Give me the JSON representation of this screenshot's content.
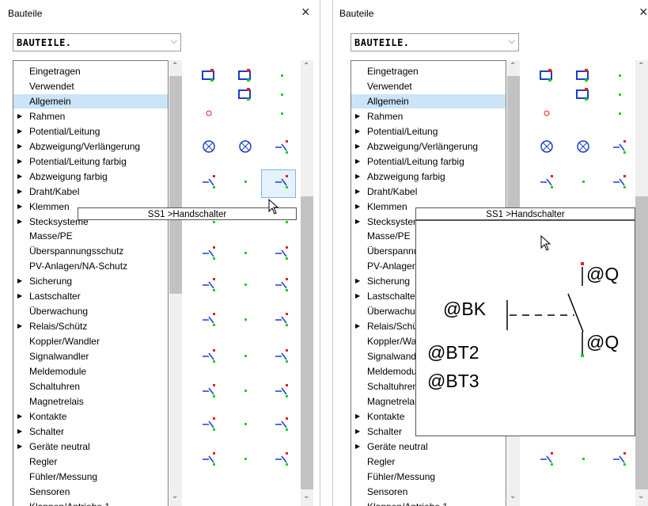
{
  "panels": [
    {
      "title": "Bauteile",
      "close": "×",
      "combo_value": "BAUTEILE.",
      "combo_arrow": "⌵"
    },
    {
      "title": "Bauteile",
      "close": "×",
      "combo_value": "BAUTEILE.",
      "combo_arrow": "⌵"
    }
  ],
  "list_items": [
    {
      "label": "Eingetragen",
      "expandable": false
    },
    {
      "label": "Verwendet",
      "expandable": false
    },
    {
      "label": "Allgemein",
      "expandable": false,
      "selected": true
    },
    {
      "label": "Rahmen",
      "expandable": true
    },
    {
      "label": "Potential/Leitung",
      "expandable": true
    },
    {
      "label": "Abzweigung/Verlängerung",
      "expandable": true
    },
    {
      "label": "Potential/Leitung  farbig",
      "expandable": true
    },
    {
      "label": "Abzweigung       farbig",
      "expandable": true
    },
    {
      "label": "Draht/Kabel",
      "expandable": true
    },
    {
      "label": "Klemmen",
      "expandable": true
    },
    {
      "label": "Stecksysteme",
      "expandable": true
    },
    {
      "label": "Masse/PE",
      "expandable": false
    },
    {
      "label": "Überspannungsschutz",
      "expandable": false
    },
    {
      "label": "PV-Anlagen/NA-Schutz",
      "expandable": false
    },
    {
      "label": "Sicherung",
      "expandable": true
    },
    {
      "label": "Lastschalter",
      "expandable": true
    },
    {
      "label": "Überwachung",
      "expandable": false
    },
    {
      "label": "Relais/Schütz",
      "expandable": true
    },
    {
      "label": "Koppler/Wandler",
      "expandable": false
    },
    {
      "label": "Signalwandler",
      "expandable": false
    },
    {
      "label": "Meldemodule",
      "expandable": false
    },
    {
      "label": "Schaltuhren",
      "expandable": false
    },
    {
      "label": "Magnetrelais",
      "expandable": false
    },
    {
      "label": "Kontakte",
      "expandable": true
    },
    {
      "label": "Schalter",
      "expandable": true
    },
    {
      "label": "Geräte neutral",
      "expandable": true
    },
    {
      "label": "Regler",
      "expandable": false
    },
    {
      "label": "Fühler/Messung",
      "expandable": false
    },
    {
      "label": "Sensoren",
      "expandable": false
    },
    {
      "label": "Klappen/Antriebe 1",
      "expandable": false
    }
  ],
  "tooltip": "SS1 >Handschalter",
  "preview": {
    "q1": "@Q",
    "q2": "@Q",
    "bk": "@BK",
    "bt2": "@BT2",
    "bt3": "@BT3"
  },
  "icons": {
    "expand": "▶",
    "scroll_up": "⌃",
    "scroll_down": "⌄"
  }
}
